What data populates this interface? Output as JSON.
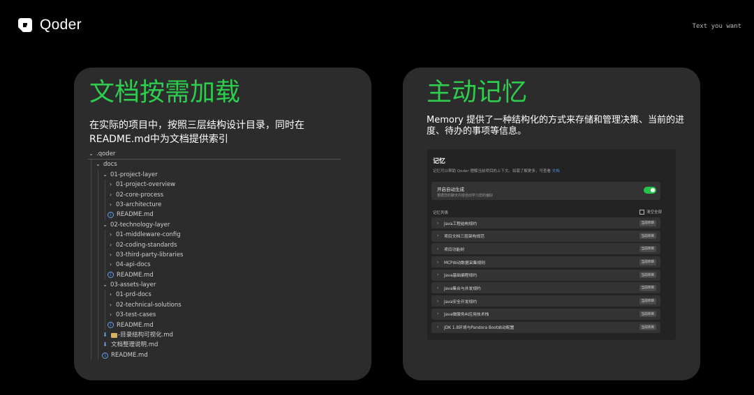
{
  "brand": {
    "name": "Qoder",
    "tagline": "Text you want",
    "logo_icon": "qoder-logo-icon"
  },
  "colors": {
    "accent": "#2ecc4f",
    "card_bg": "#2c2c2c",
    "link": "#4a8ff0",
    "toggle_on": "#27c14b"
  },
  "left_card": {
    "title": "文档按需加载",
    "description": "在实际的项目中，按照三层结构设计目录，同时在README.md中为文档提供索引",
    "tree": [
      {
        "depth": 0,
        "kind": "folder-open",
        "label": ".qoder"
      },
      {
        "depth": 1,
        "kind": "folder-open",
        "label": "docs"
      },
      {
        "depth": 2,
        "kind": "folder-open",
        "label": "01-project-layer"
      },
      {
        "depth": 3,
        "kind": "folder-closed",
        "label": "01-project-overview"
      },
      {
        "depth": 3,
        "kind": "folder-closed",
        "label": "02-core-process"
      },
      {
        "depth": 3,
        "kind": "folder-closed",
        "label": "03-architecture"
      },
      {
        "depth": 3,
        "kind": "info",
        "label": "README.md"
      },
      {
        "depth": 2,
        "kind": "folder-open",
        "label": "02-technology-layer"
      },
      {
        "depth": 3,
        "kind": "folder-closed",
        "label": "01-middleware-config"
      },
      {
        "depth": 3,
        "kind": "folder-closed",
        "label": "02-coding-standards"
      },
      {
        "depth": 3,
        "kind": "folder-closed",
        "label": "03-third-party-libraries"
      },
      {
        "depth": 3,
        "kind": "folder-closed",
        "label": "04-api-docs"
      },
      {
        "depth": 3,
        "kind": "info",
        "label": "README.md"
      },
      {
        "depth": 2,
        "kind": "folder-open",
        "label": "03-assets-layer"
      },
      {
        "depth": 3,
        "kind": "folder-closed",
        "label": "01-prd-docs"
      },
      {
        "depth": 3,
        "kind": "folder-closed",
        "label": "02-technical-solutions"
      },
      {
        "depth": 3,
        "kind": "folder-closed",
        "label": "03-test-cases"
      },
      {
        "depth": 3,
        "kind": "info",
        "label": "README.md"
      },
      {
        "depth": 2,
        "kind": "download",
        "label": "-目录结构可视化.md",
        "prefix_icon": "folder-emoji-icon"
      },
      {
        "depth": 2,
        "kind": "download",
        "label": "文档整理说明.md"
      },
      {
        "depth": 2,
        "kind": "info",
        "label": "README.md"
      }
    ]
  },
  "right_card": {
    "title": "主动记忆",
    "description": "Memory 提供了一种结构化的方式来存储和管理决策、当前的进度、待办的事项等信息。",
    "memory_panel": {
      "title": "记忆",
      "subtitle": "记忆可以帮助 Qoder 理解当前项目的上下文。如需了解更多，可查看",
      "subtitle_link": "文档",
      "auto_label": "开启自动生成",
      "auto_desc": "根据您的聊天内容自动学习您的偏好",
      "auto_enabled": true,
      "list_label": "记忆列表",
      "clear_label": "清空全部",
      "badge": "当前项目",
      "items": [
        "Java工程结构规约",
        "项目文档三层架构规范",
        "项目功能树",
        "MCP自动数据采集规则",
        "Java基础编程规约",
        "Java集合与并发规约",
        "Java安全开发规约",
        "Java微服务AI应用技术栈",
        "JDK 1.8环境与Pandora Boot启动配置"
      ]
    }
  }
}
